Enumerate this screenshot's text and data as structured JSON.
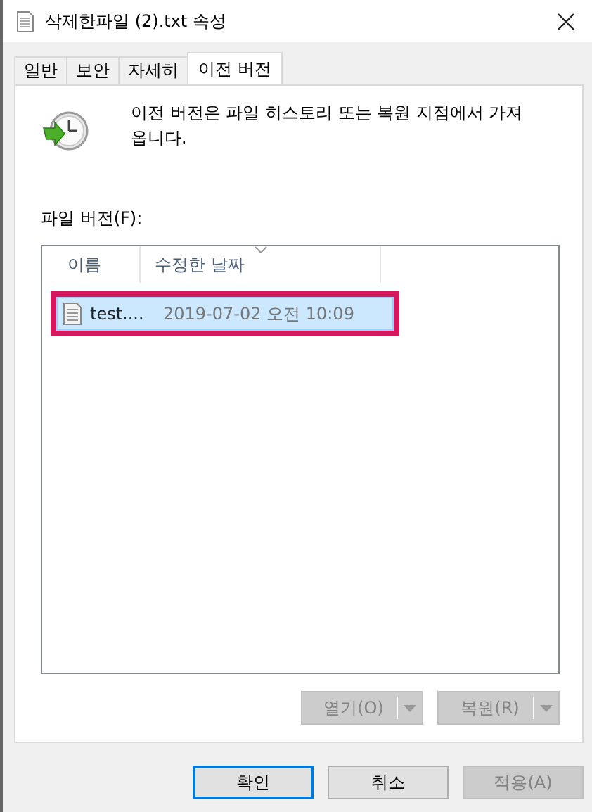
{
  "window": {
    "title": "삭제한파일 (2).txt 속성"
  },
  "tabs": [
    {
      "label": "일반",
      "selected": false
    },
    {
      "label": "보안",
      "selected": false
    },
    {
      "label": "자세히",
      "selected": false
    },
    {
      "label": "이전 버전",
      "selected": true
    }
  ],
  "description": "이전 버전은 파일 히스토리 또는 복원 지점에서 가져옵니다.",
  "list_label": "파일 버전(F):",
  "columns": [
    {
      "label": "이름",
      "sorted": false
    },
    {
      "label": "수정한 날짜",
      "sorted": true
    }
  ],
  "rows": [
    {
      "name": "test....",
      "date": "2019-07-02 오전 10:09",
      "selected": true,
      "highlighted": true
    }
  ],
  "list_buttons": [
    {
      "label": "열기(O)",
      "disabled": true
    },
    {
      "label": "복원(R)",
      "disabled": true
    }
  ],
  "dialog_buttons": [
    {
      "label": "확인",
      "default": true,
      "disabled": false
    },
    {
      "label": "취소",
      "default": false,
      "disabled": false
    },
    {
      "label": "적용(A)",
      "default": false,
      "disabled": true
    }
  ]
}
